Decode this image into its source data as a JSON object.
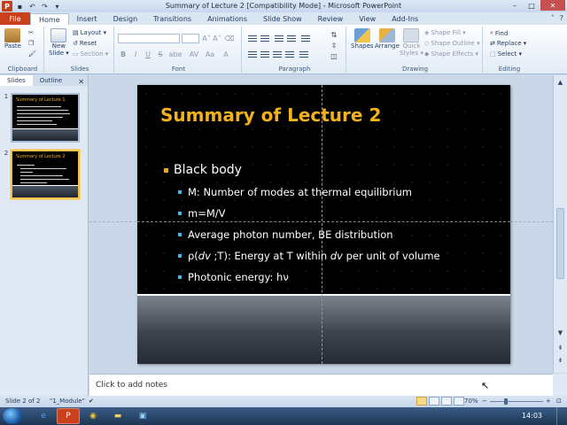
{
  "window": {
    "title": "Summary of Lecture 2 [Compatibility Mode] - Microsoft PowerPoint",
    "app_logo": "P",
    "qat_icons": [
      "save-icon",
      "undo-icon",
      "redo-icon",
      "customize-qat-icon"
    ],
    "controls": {
      "minimize": "–",
      "maximize": "□",
      "close": "✕"
    }
  },
  "ribbon_tabs": [
    "File",
    "Home",
    "Insert",
    "Design",
    "Transitions",
    "Animations",
    "Slide Show",
    "Review",
    "View",
    "Add-Ins"
  ],
  "ribbon": {
    "clipboard": {
      "label": "Clipboard",
      "paste": "Paste"
    },
    "slides": {
      "label": "Slides",
      "new_slide": "New",
      "new_slide_2": "Slide ▾",
      "layout": "Layout ▾",
      "reset": "Reset",
      "section": "Section ▾"
    },
    "font": {
      "label": "Font",
      "bold": "B",
      "italic": "I",
      "underline": "U",
      "strike": "S",
      "shadow": "abe",
      "spacing": "AV",
      "case": "Aa",
      "color": "A",
      "grow": "A˄",
      "shrink": "A˅"
    },
    "paragraph": {
      "label": "Paragraph"
    },
    "drawing": {
      "label": "Drawing",
      "shapes": "Shapes",
      "arrange": "Arrange",
      "quick_styles": "Quick",
      "quick_styles_2": "Styles ▾",
      "shape_fill": "Shape Fill ▾",
      "shape_outline": "Shape Outline ▾",
      "shape_effects": "Shape Effects ▾"
    },
    "editing": {
      "label": "Editing",
      "find": "Find",
      "replace": "Replace ▾",
      "select": "Select ▾"
    }
  },
  "pane": {
    "tabs": [
      "Slides",
      "Outline"
    ],
    "close": "✕"
  },
  "thumbnails": [
    {
      "number": "1",
      "title": "Summary of Lecture 1"
    },
    {
      "number": "2",
      "title": "Summary of Lecture 2"
    }
  ],
  "slide": {
    "title": "Summary of Lecture 2",
    "bullet": "Black body",
    "sub_bullets": [
      "M: Number of modes at thermal equilibrium",
      "m=M/V",
      "Average photon number, BE distribution"
    ],
    "energy_bullet": {
      "pre": "ρ(",
      "v1": "dv",
      "mid": " ;T): Energy at T within ",
      "v2": "dv",
      "post": " per unit of volume"
    },
    "photonic_bullet": "Photonic energy: hν"
  },
  "notes": {
    "placeholder": "Click to add notes"
  },
  "status": {
    "slide": "Slide 2 of 2",
    "theme": "\"1_Module\"",
    "zoom": "70%",
    "zoom_out": "−",
    "zoom_in": "+"
  },
  "taskbar": {
    "clock": "14:03",
    "apps": [
      "ie-icon",
      "powerpoint-icon",
      "chrome-icon",
      "explorer-icon",
      "app-icon"
    ]
  },
  "colors": {
    "title_gold": "#f2b21c",
    "bullet_orange": "#f2a318",
    "bullet_blue": "#4fb5e6",
    "file_tab": "#c9401c"
  }
}
